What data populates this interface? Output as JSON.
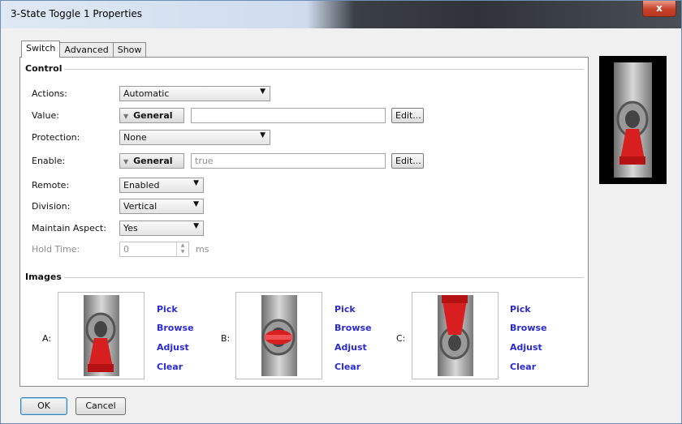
{
  "window": {
    "title": "3-State Toggle 1 Properties",
    "close_glyph": "x"
  },
  "tabs": [
    "Switch",
    "Advanced",
    "Show"
  ],
  "control": {
    "header": "Control",
    "actions": {
      "label": "Actions:",
      "value": "Automatic"
    },
    "value": {
      "label": "Value:",
      "mode": "General",
      "text": "",
      "edit": "Edit..."
    },
    "protection": {
      "label": "Protection:",
      "value": "None"
    },
    "enable": {
      "label": "Enable:",
      "mode": "General",
      "text": "true",
      "edit": "Edit..."
    },
    "remote": {
      "label": "Remote:",
      "value": "Enabled"
    },
    "division": {
      "label": "Division:",
      "value": "Vertical"
    },
    "maintain_aspect": {
      "label": "Maintain Aspect:",
      "value": "Yes"
    },
    "hold_time": {
      "label": "Hold Time:",
      "value": "0",
      "unit": "ms"
    }
  },
  "images": {
    "header": "Images",
    "slots": [
      {
        "label": "A:",
        "state": "down",
        "links": [
          "Pick",
          "Browse",
          "Adjust",
          "Clear"
        ]
      },
      {
        "label": "B:",
        "state": "middle",
        "links": [
          "Pick",
          "Browse",
          "Adjust",
          "Clear"
        ]
      },
      {
        "label": "C:",
        "state": "up",
        "links": [
          "Pick",
          "Browse",
          "Adjust",
          "Clear"
        ]
      }
    ]
  },
  "footer": {
    "ok": "OK",
    "cancel": "Cancel"
  },
  "colors": {
    "toggle_red": "#d81f1f",
    "link_blue": "#2a2ad0"
  },
  "icons": {
    "dropdown": "chevron-down-icon",
    "spinner": "spinner-arrows-icon"
  }
}
